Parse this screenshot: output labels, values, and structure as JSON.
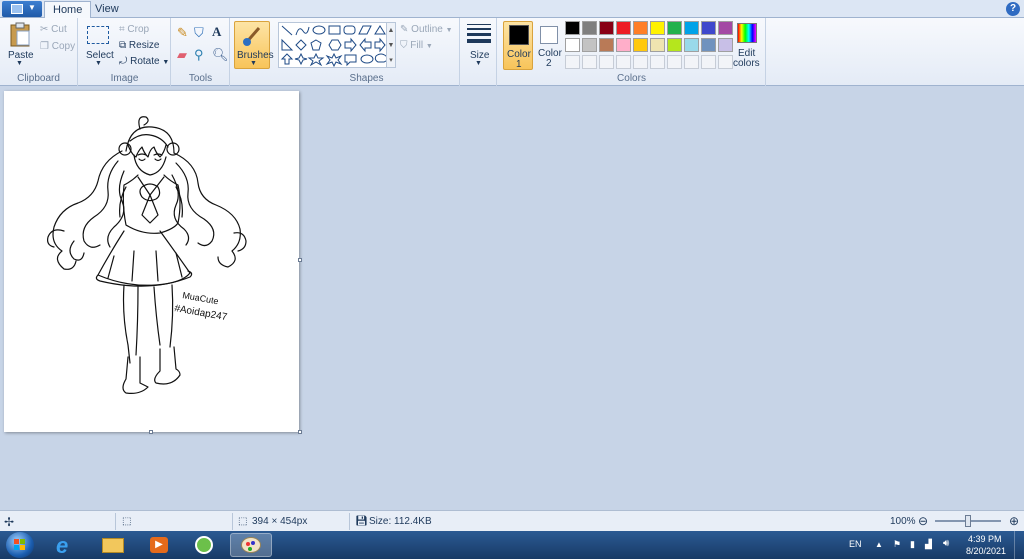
{
  "tabs": {
    "home": "Home",
    "view": "View",
    "help": "?"
  },
  "clipboard": {
    "paste": "Paste",
    "cut": "Cut",
    "copy": "Copy",
    "label": "Clipboard"
  },
  "image": {
    "select": "Select",
    "crop": "Crop",
    "resize": "Resize",
    "rotate": "Rotate",
    "label": "Image"
  },
  "tools": {
    "label": "Tools"
  },
  "brushes": {
    "label": "Brushes"
  },
  "shapes": {
    "outline": "Outline",
    "fill": "Fill",
    "label": "Shapes"
  },
  "size": {
    "label": "Size"
  },
  "colors": {
    "color1_line1": "Color",
    "color1_line2": "1",
    "color2_line1": "Color",
    "color2_line2": "2",
    "edit_line1": "Edit",
    "edit_line2": "colors",
    "label": "Colors",
    "color1_value": "#000000",
    "color2_value": "#ffffff",
    "row1": [
      "#000000",
      "#7f7f7f",
      "#880015",
      "#ed1c24",
      "#ff7f27",
      "#fff200",
      "#22b14c",
      "#00a2e8",
      "#3f48cc",
      "#a349a4"
    ],
    "row2": [
      "#ffffff",
      "#c3c3c3",
      "#b97a57",
      "#ffaec9",
      "#ffc90e",
      "#efe4b0",
      "#b5e61d",
      "#99d9ea",
      "#7092be",
      "#c8bfe7"
    ]
  },
  "drawing": {
    "signature_line1": "MuaCute",
    "signature_line2": "#Aoidap247"
  },
  "status": {
    "dimensions": "394 × 454px",
    "size": "Size: 112.4KB",
    "zoom": "100%",
    "zoom_level": 1.0
  },
  "taskbar": {
    "lang": "EN",
    "time": "4:39 PM",
    "date": "8/20/2021"
  }
}
